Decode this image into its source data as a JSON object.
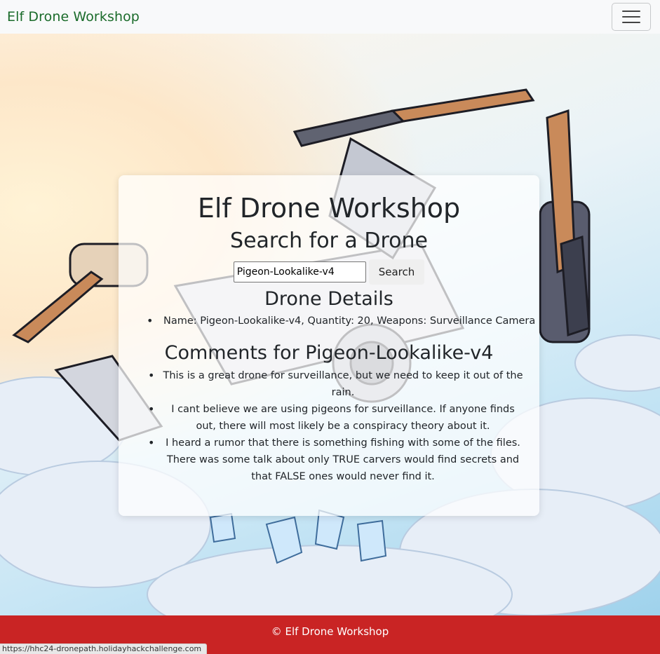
{
  "navbar": {
    "brand": "Elf Drone Workshop",
    "menu_icon": "hamburger-menu-icon"
  },
  "hero": {
    "background_description_icon": "drone-illustration"
  },
  "card": {
    "title": "Elf Drone Workshop",
    "search_heading": "Search for a Drone",
    "search_input_value": "Pigeon-Lookalike-v4",
    "search_button_label": "Search",
    "details_heading": "Drone Details",
    "details": [
      "Name: Pigeon-Lookalike-v4, Quantity: 20, Weapons: Surveillance Camera"
    ],
    "comments_heading": "Comments for Pigeon-Lookalike-v4",
    "comments": [
      "This is a great drone for surveillance, but we need to keep it out of the rain.",
      "I cant believe we are using pigeons for surveillance. If anyone finds out, there will most likely be a conspiracy theory about it.",
      "I heard a rumor that there is something fishing with some of the files. There was some talk about only TRUE carvers would find secrets and that FALSE ones would never find it."
    ]
  },
  "footer": {
    "text": "© Elf Drone Workshop"
  },
  "status_bar": {
    "url": "https://hhc24-dronepath.holidayhackchallenge.com"
  },
  "colors": {
    "navbar_bg": "#f8f9fa",
    "brand": "#1a6b2a",
    "footer_bg": "#c92424"
  }
}
